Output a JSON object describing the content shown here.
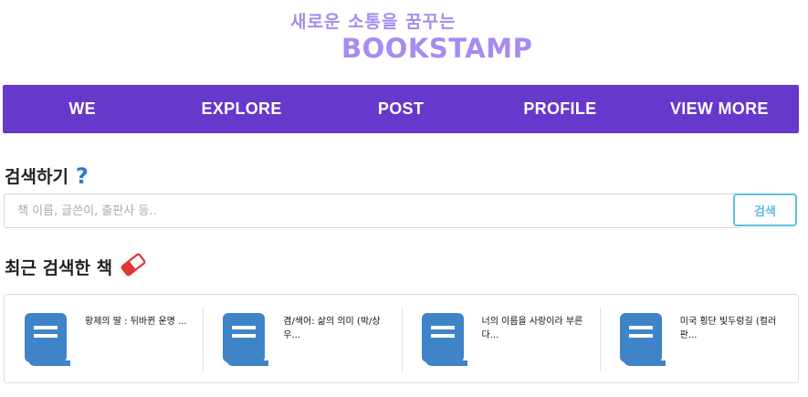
{
  "header": {
    "tagline": "새로운 소통을 꿈꾸는",
    "title": "BOOKSTAMP"
  },
  "nav": {
    "items": [
      "WE",
      "EXPLORE",
      "POST",
      "PROFILE",
      "VIEW MORE"
    ]
  },
  "search": {
    "title": "검색하기",
    "placeholder": "책 이름, 글쓴이, 출판사 등..",
    "value": "",
    "button_label": "검색"
  },
  "recent": {
    "title": "최근 검색한 책",
    "books": [
      {
        "title": "황제의 딸 : 뒤바뀐 운명 ...",
        "icon": "book-icon"
      },
      {
        "title": "겸/색어: 삶의 의미 (박/상 우...",
        "icon": "book-icon"
      },
      {
        "title": "너의 이름을 사랑이라 부른 다...",
        "icon": "book-icon"
      },
      {
        "title": "미국 횡단 빛두렁길 (컬러 판...",
        "icon": "book-icon"
      }
    ]
  },
  "colors": {
    "nav_bg": "#6638cc",
    "logo": "#a78bf0",
    "help_icon": "#2a7ec9",
    "book_icon": "#3f83c8",
    "eraser_icon": "#e0343a",
    "search_button": "#5bc0de"
  }
}
